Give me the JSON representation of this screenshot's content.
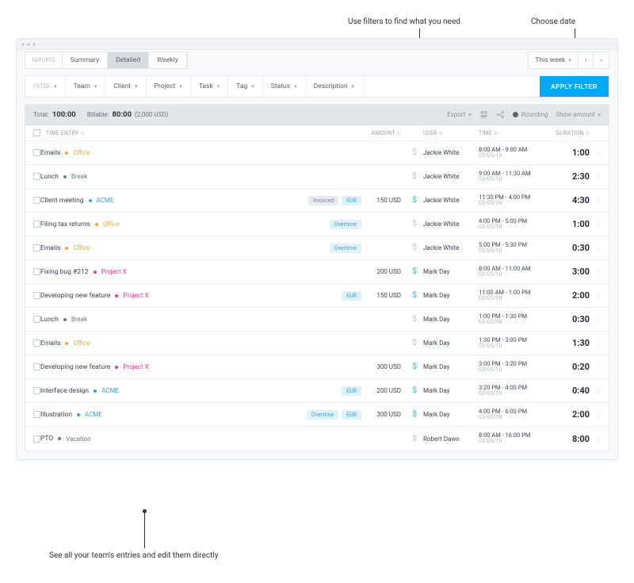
{
  "annotations": {
    "filters": "Use filters to find what you need",
    "choose_date": "Choose date",
    "entries": "See all your team's entries and edit them directly"
  },
  "tabs": {
    "label": "REPORTS",
    "items": [
      "Summary",
      "Detailed",
      "Weekly"
    ],
    "active": "Detailed"
  },
  "date_picker": {
    "label": "This week"
  },
  "filters": {
    "header": "FILTER",
    "items": [
      "Team",
      "Client",
      "Project",
      "Task",
      "Tag",
      "Status",
      "Description"
    ],
    "apply": "APPLY FILTER"
  },
  "summary": {
    "total_label": "Total:",
    "total_value": "100:00",
    "billable_label": "Billable:",
    "billable_value": "80:00",
    "billable_amount": "(2,000 USD)",
    "export": "Export",
    "rounding": "Rounding",
    "show_amount": "Show amount"
  },
  "columns": {
    "entry": "TIME ENTRY",
    "amount": "AMOUNT",
    "user": "USER",
    "time": "TIME",
    "duration": "DURATION"
  },
  "projects": {
    "office": {
      "name": "Office",
      "color": "#f2a93b"
    },
    "break": {
      "name": "Break",
      "color": "#6c7a89"
    },
    "acme": {
      "name": "ACME",
      "color": "#3aa6e0"
    },
    "projectx": {
      "name": "Project X",
      "color": "#e83e8c"
    },
    "vacation": {
      "name": "Vacation",
      "color": "#6c7a89"
    }
  },
  "badges": {
    "invoiced": "Invoiced",
    "eur": "EUR",
    "overtime": "Overtime"
  },
  "rows": [
    {
      "title": "Emails",
      "project": "office",
      "badges": [],
      "amount": "",
      "billable": false,
      "user": "Jackie White",
      "time": "8:00 AM - 9:00 AM",
      "date": "03/05/18",
      "duration": "1:00"
    },
    {
      "title": "Lunch",
      "project": "break",
      "badges": [],
      "amount": "",
      "billable": false,
      "user": "Jackie White",
      "time": "9:00 AM - 11:30 AM",
      "date": "03/05/18",
      "duration": "2:30"
    },
    {
      "title": "Client meeting",
      "project": "acme",
      "badges": [
        "invoiced",
        "eur"
      ],
      "amount": "150 USD",
      "billable": true,
      "user": "Jackie White",
      "time": "11:30 PM - 4:00 PM",
      "date": "03/05/18",
      "duration": "4:30"
    },
    {
      "title": "Filing tax returns",
      "project": "office",
      "badges": [
        "overtime"
      ],
      "amount": "",
      "billable": false,
      "user": "Jackie White",
      "time": "4:00 PM - 5:00 PM",
      "date": "03/05/18",
      "duration": "1:00"
    },
    {
      "title": "Emails",
      "project": "office",
      "badges": [
        "overtime"
      ],
      "amount": "",
      "billable": false,
      "user": "Jackie White",
      "time": "5:00 PM - 5:30 PM",
      "date": "03/05/18",
      "duration": "0:30"
    },
    {
      "title": "Fixing bug #212",
      "project": "projectx",
      "badges": [],
      "amount": "200 USD",
      "billable": true,
      "user": "Mark Day",
      "time": "8:00 AM - 11:00 AM",
      "date": "03/05/18",
      "duration": "3:00"
    },
    {
      "title": "Developing new feature",
      "project": "projectx",
      "badges": [
        "eur"
      ],
      "amount": "150 USD",
      "billable": true,
      "user": "Mark Day",
      "time": "11:00 AM - 1:00 PM",
      "date": "03/05/18",
      "duration": "2:00"
    },
    {
      "title": "Lunch",
      "project": "break",
      "badges": [],
      "amount": "",
      "billable": false,
      "user": "Mark Day",
      "time": "1:00 PM - 1:30 PM",
      "date": "03/05/18",
      "duration": "0:30"
    },
    {
      "title": "Emails",
      "project": "office",
      "badges": [],
      "amount": "",
      "billable": false,
      "user": "Mark Day",
      "time": "1:30 PM - 3:00 PM",
      "date": "03/05/18",
      "duration": "1:30"
    },
    {
      "title": "Developing new feature",
      "project": "projectx",
      "badges": [],
      "amount": "300 USD",
      "billable": true,
      "user": "Mark Day",
      "time": "3:00 PM - 3:20 PM",
      "date": "03/05/18",
      "duration": "0:20"
    },
    {
      "title": "Interface design",
      "project": "acme",
      "badges": [
        "eur"
      ],
      "amount": "200 USD",
      "billable": true,
      "user": "Mark Day",
      "time": "3:20 PM - 4:00 PM",
      "date": "03/05/18",
      "duration": "0:40"
    },
    {
      "title": "Illustration",
      "project": "acme",
      "badges": [
        "overtime",
        "eur"
      ],
      "amount": "300 USD",
      "billable": true,
      "user": "Mark Day",
      "time": "4:00 PM - 6:00 PM",
      "date": "03/05/18",
      "duration": "2:00"
    },
    {
      "title": "PTO",
      "project": "vacation",
      "badges": [],
      "amount": "",
      "billable": false,
      "user": "Robert Dawn",
      "time": "8:00 AM - 16:00 PM",
      "date": "03/05/18",
      "duration": "8:00"
    }
  ]
}
